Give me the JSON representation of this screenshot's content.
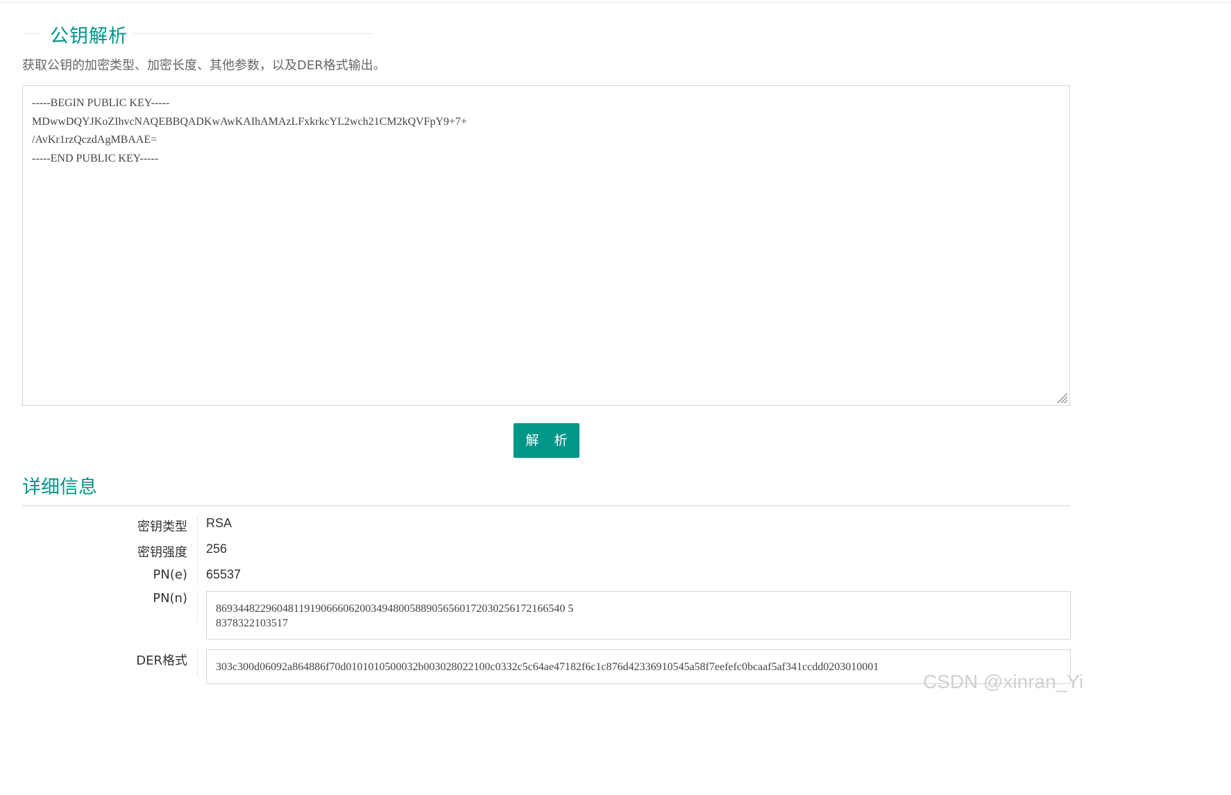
{
  "header": {
    "title": "公钥解析",
    "subtitle": "获取公钥的加密类型、加密长度、其他参数，以及DER格式输出。"
  },
  "input": {
    "value": "-----BEGIN PUBLIC KEY-----\nMDwwDQYJKoZIhvcNAQEBBQADKwAwKAIhAMAzLFxkrkcYL2wch21CM2kQVFpY9+7+\n/AvKr1rzQczdAgMBAAE=\n-----END PUBLIC KEY-----"
  },
  "parse_button": {
    "label": "解 析"
  },
  "details": {
    "title": "详细信息",
    "key_type_label": "密钥类型",
    "key_type_value": "RSA",
    "key_strength_label": "密钥强度",
    "key_strength_value": "256",
    "pn_e_label": "PN(e)",
    "pn_e_value": "65537",
    "pn_n_label": "PN(n)",
    "pn_n_value": "869344822960481191906660620034948005889056560172030256172166540 5\n8378322103517",
    "der_label": "DER格式",
    "der_value": "303c300d06092a864886f70d0101010500032b003028022100c0332c5c64ae47182f6c1c876d42336910545a58f7eefefc0bcaaf5af341ccdd0203010001"
  },
  "watermark": "CSDN @xinran_Yi",
  "colors": {
    "accent": "#009688"
  }
}
